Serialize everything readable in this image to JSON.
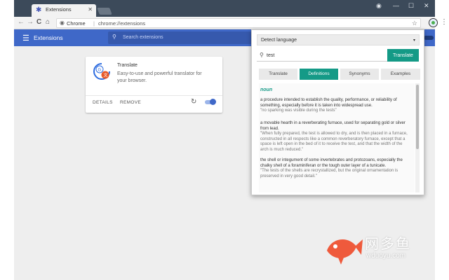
{
  "browser": {
    "tab_title": "Extensions",
    "tab_close": "✕",
    "window_controls": {
      "account": "◉",
      "minimize": "—",
      "maximize": "☐",
      "close": "✕"
    },
    "nav": {
      "back": "←",
      "forward": "→",
      "reload": "C",
      "home": "⌂"
    },
    "omnibox": {
      "scheme_label": "Chrome",
      "separator": "|",
      "url": "chrome://extensions"
    },
    "star": "☆",
    "menu": "⋮"
  },
  "extensions_page": {
    "title": "Extensions",
    "search_placeholder": "Search extensions",
    "card": {
      "name": "Translate",
      "description": "Easy-to-use and powerful translator for your browser.",
      "details_label": "DETAILS",
      "remove_label": "REMOVE",
      "reload_symbol": "↻"
    }
  },
  "popup": {
    "language": "Detect language",
    "caret": "▾",
    "query": "test",
    "translate_label": "Translate",
    "tabs": [
      {
        "label": "Translate"
      },
      {
        "label": "Definitions",
        "active": true
      },
      {
        "label": "Synonyms"
      },
      {
        "label": "Examples"
      }
    ],
    "part_of_speech": "noun",
    "definitions": [
      {
        "text": "a procedure intended to establish the quality, performance, or reliability of something, especially before it is taken into widespread use.",
        "example": "\"no sparking was visible during the tests\""
      },
      {
        "text": "a movable hearth in a reverberating furnace, used for separating gold or silver from lead.",
        "example": "\"When fully prepared, the test is allowed to dry, and is then placed in a furnace, constructed in all respects like a common reverberatory furnace, except that a space is left open in the bed of it to receive the test, and that the width of the arch is much reduced.\""
      },
      {
        "text": "the shell or integument of some invertebrates and protozoans, especially the chalky shell of a foraminiferan or the tough outer layer of a tunicate.",
        "example": "\"The tests of the shells are recrystallized, but the original ornamentation is preserved in very good detail.\""
      }
    ]
  },
  "watermark": {
    "cn": "网多鱼",
    "en": "wduoyu.com"
  },
  "colors": {
    "appbar": "#3f68c8",
    "accent": "#159a87",
    "titlebar": "#3c4a5a"
  }
}
